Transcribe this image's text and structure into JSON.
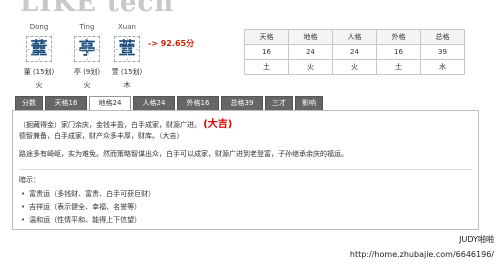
{
  "logo": "LIKE tech",
  "chars": [
    {
      "pinyin": "Dong",
      "char": "董",
      "strokes": "董 (15划)",
      "element": "火"
    },
    {
      "pinyin": "Ting",
      "char": "亭",
      "strokes": "亭 (9划)",
      "element": "火"
    },
    {
      "pinyin": "Xuan",
      "char": "萱",
      "strokes": "萱 (15划)",
      "element": "木"
    }
  ],
  "score": "-> 92.65分",
  "ge_table": {
    "headers": [
      "天格",
      "地格",
      "人格",
      "外格",
      "总格"
    ],
    "numbers": [
      "16",
      "24",
      "24",
      "16",
      "39"
    ],
    "elements": [
      "土",
      "火",
      "火",
      "土",
      "水"
    ]
  },
  "tabs": [
    "分数",
    "天格16",
    "地格24",
    "人格24",
    "外格16",
    "总格39",
    "三才",
    "影响"
  ],
  "content": {
    "line1": "（掘藏得金）家门余庆，金钱丰盈，白手成家，财源广进。",
    "line1_mark": "(大吉)",
    "line2": "德智兼备，白手成家，财产众多丰厚，财库。（大吉）",
    "line3": "路途多有崎岖，实为难免。然而策略智谋出众，白手可以成家，财源广进到老登富，子孙继承余庆的福运。",
    "hint_title": "暗示：",
    "hints": [
      "富贵运（多钱财、富贵、白手可获巨财）",
      "吉祥运（表示健全、幸福、名誉等）",
      "温和运（性情平和、能得上下信望）"
    ]
  },
  "credit": "JUDY啪啪",
  "url": "http://home.zhubajie.com/6646196/"
}
